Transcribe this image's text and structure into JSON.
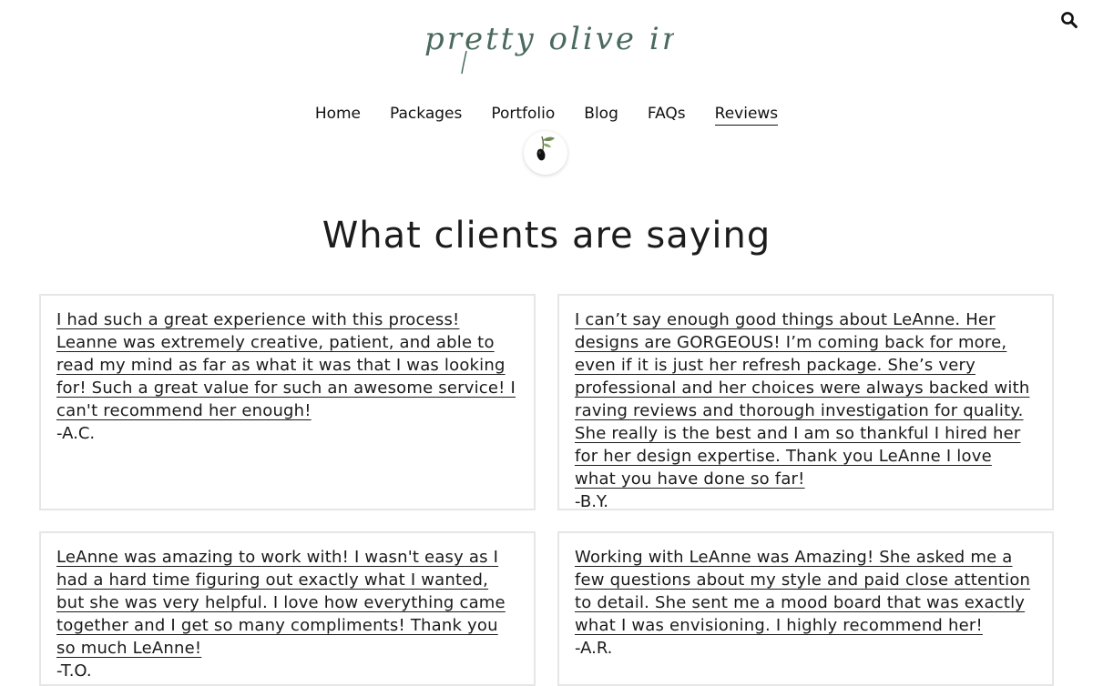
{
  "brand": {
    "logo_text": "pretty olive interiors"
  },
  "icons": {
    "search": "search-icon",
    "olive": "olive-branch-icon"
  },
  "nav": {
    "items": [
      {
        "label": "Home",
        "active": false
      },
      {
        "label": "Packages",
        "active": false
      },
      {
        "label": "Portfolio",
        "active": false
      },
      {
        "label": "Blog",
        "active": false
      },
      {
        "label": "FAQs",
        "active": false
      },
      {
        "label": "Reviews",
        "active": true
      }
    ]
  },
  "page": {
    "title": "What clients are saying"
  },
  "reviews": [
    {
      "text": "I had such a great experience with this process! Leanne was extremely creative, patient, and able to read my mind as far as what it was that I was looking for! Such a great value for such an awesome service! I can't recommend her enough!",
      "author": "-A.C."
    },
    {
      "text": "I can’t say enough good things about LeAnne. Her designs are GORGEOUS! I’m coming back for more, even if it is just her refresh package. She’s very professional and her choices were always backed with raving reviews and thorough investigation for quality. She really is the best and I am so thankful I hired her for her design expertise. Thank you LeAnne I love what you have done so far!",
      "author": "-B.Y."
    },
    {
      "text": "LeAnne was amazing to work with! I wasn't easy as I had a hard time figuring out exactly what I wanted, but she was very helpful. I love how everything came together and I get so many compliments! Thank you so much LeAnne!",
      "author": "-T.O."
    },
    {
      "text": "Working with LeAnne was Amazing! She asked me a few questions about my style and paid close attention to detail. She sent me a mood board that was exactly what I was envisioning. I highly recommend her!",
      "author": "-A.R."
    }
  ],
  "colors": {
    "logo": "#4a6a5d",
    "text": "#1a1a1a",
    "card_border": "#e6e6e6",
    "background": "#ffffff"
  }
}
